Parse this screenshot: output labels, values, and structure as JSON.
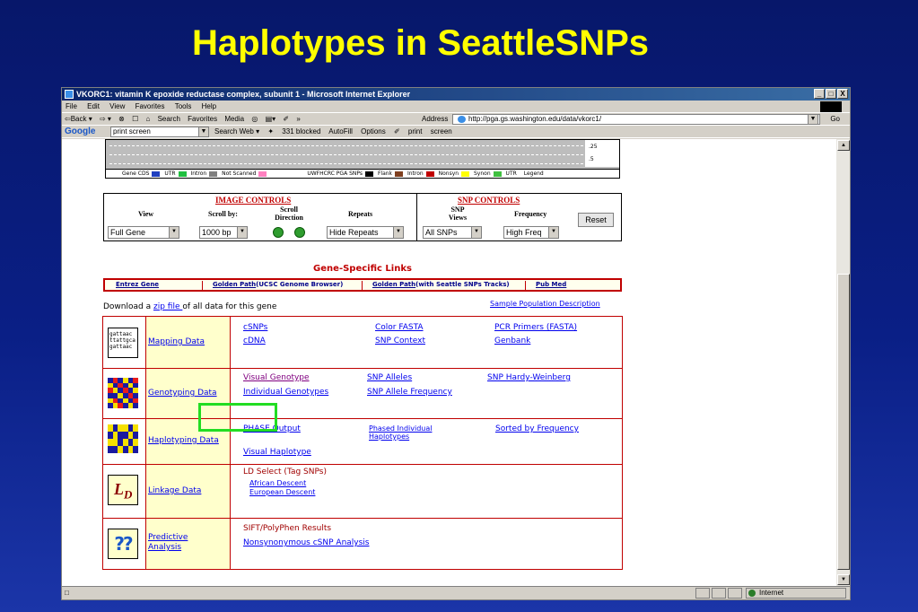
{
  "slide": {
    "title": "Haplotypes in SeattleSNPs"
  },
  "window": {
    "title": "VKORC1: vitamin K epoxide reductase complex, subunit 1 - Microsoft Internet Explorer",
    "controls": [
      "_",
      "□",
      "X"
    ]
  },
  "menu": [
    "File",
    "Edit",
    "View",
    "Favorites",
    "Tools",
    "Help"
  ],
  "toolbar": {
    "items": [
      "⇦Back ▾",
      "⇨ ▾",
      "⊗",
      "☐",
      "⌂",
      "Search",
      "Favorites",
      "Media",
      "◎",
      "▤▾",
      "✐",
      "»"
    ],
    "address_label": "Address",
    "address": "http://pga.gs.washington.edu/data/vkorc1/",
    "go": "Go"
  },
  "googlebar": {
    "logo": "Google",
    "query": "print screen",
    "items": [
      "Search Web ▾",
      "✦",
      "331 blocked",
      "AutoFill",
      "Options",
      "✐",
      "print",
      "screen"
    ]
  },
  "track": {
    "scale_top": ".25",
    "scale_bottom": ".5",
    "legend_items": [
      "Gene",
      "CDS",
      "UTR",
      "Intron",
      "Not Scanned",
      "UWFHCRC PGA SNPs",
      "Flank",
      "Intron",
      "Nonsyn",
      "Synon",
      "UTR",
      "Legend"
    ],
    "legend_colors": [
      "#2040c0",
      "#20c040",
      "#808080",
      "#ff80c0",
      "#000000",
      "#804020",
      "#c00000",
      "#ffff00",
      "#40c040"
    ]
  },
  "image_controls": {
    "heading": "IMAGE CONTROLS",
    "view_label": "View",
    "scroll_label": "Scroll by:",
    "direction_label": "Scroll Direction",
    "repeats_label": "Repeats",
    "view_value": "Full Gene",
    "scroll_value": "1000 bp",
    "repeats_value": "Hide Repeats"
  },
  "snp_controls": {
    "heading": "SNP CONTROLS",
    "views_label": "SNP Views",
    "frequency_label": "Frequency",
    "views_value": "All SNPs",
    "frequency_value": "High Freq",
    "reset": "Reset"
  },
  "gene_links": {
    "title": "Gene-Specific Links",
    "entrez": "Entrez Gene",
    "golden1": "Golden Path",
    "golden1_suffix": "(UCSC Genome Browser)",
    "golden2": "Golden Path",
    "golden2_suffix": "(with Seattle SNPs Tracks)",
    "pubmed": "Pub Med"
  },
  "download": {
    "prefix": "Download a ",
    "link": "zip file ",
    "suffix": "of all data for this gene"
  },
  "sample_link": "Sample Population Description",
  "table": {
    "mapping": {
      "label": "Mapping Data",
      "icon_text": "gattaac\nttattgca\ngattaac",
      "links": [
        "cSNPs",
        "cDNA",
        "Color FASTA",
        "SNP Context",
        "PCR Primers (FASTA)",
        "Genbank"
      ]
    },
    "genotyping": {
      "label": "Genotyping Data",
      "links": [
        "Visual Genotype",
        "Individual Genotypes",
        "SNP Alleles",
        "SNP Allele Frequency",
        "SNP Hardy-Weinberg"
      ]
    },
    "haplotyping": {
      "label": "Haplotyping Data",
      "links": [
        "PHASE Output",
        "Visual Haplotype",
        "Phased Individual Haplotypes",
        "Sorted by Frequency"
      ]
    },
    "linkage": {
      "label": "Linkage Data",
      "heading": "LD Select (Tag SNPs)",
      "links": [
        "African Descent",
        "European Descent"
      ]
    },
    "predictive": {
      "label": "Predictive Analysis",
      "heading": "SIFT/PolyPhen Results",
      "links": [
        "Nonsynonymous cSNP Analysis"
      ]
    }
  },
  "status": {
    "zone": "Internet"
  },
  "colors": {
    "accent_red": "#c00000",
    "highlight": "#22dd22",
    "link": "#0000ee",
    "slide_title": "#ffff00"
  }
}
